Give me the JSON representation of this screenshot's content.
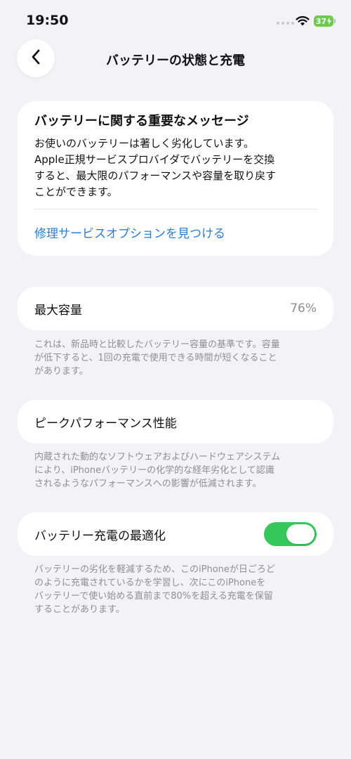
{
  "status_bar": {
    "time": "19:50",
    "battery_level": "37"
  },
  "nav": {
    "title": "バッテリーの状態と充電",
    "back_icon": "chevron-left-icon"
  },
  "message": {
    "title": "バッテリーに関する重要なメッセージ",
    "body": "お使いのバッテリーは著しく劣化しています。\nApple正規サービスプロバイダでバッテリーを交換\nすると、最大限のパフォーマンスや容量を取り戻す\nことができます。",
    "link": "修理サービスオプションを見つける"
  },
  "max_capacity": {
    "label": "最大容量",
    "value": "76%",
    "footnote": "これは、新品時と比較したバッテリー容量の基準です。容量\nが低下すると、1回の充電で使用できる時間が短くなること\nがあります。"
  },
  "peak_performance": {
    "label": "ピークパフォーマンス性能",
    "footnote": "内蔵された動的なソフトウェアおよびハードウェアシステム\nにより、iPhoneバッテリーの化学的な経年劣化として認識\nされるようなパフォーマンスへの影響が低減されます。"
  },
  "optimized_charging": {
    "label": "バッテリー充電の最適化",
    "enabled": true,
    "footnote": "バッテリーの劣化を軽減するため、このiPhoneが日ごろど\nのように充電されているかを学習し、次にこのiPhoneを\nバッテリーで使い始める直前まで80%を超える充電を保留\nすることがあります。"
  },
  "colors": {
    "background": "#f2f2f7",
    "link": "#2a7ed9",
    "toggle_on": "#34c759",
    "battery": "#6dcc4f"
  }
}
